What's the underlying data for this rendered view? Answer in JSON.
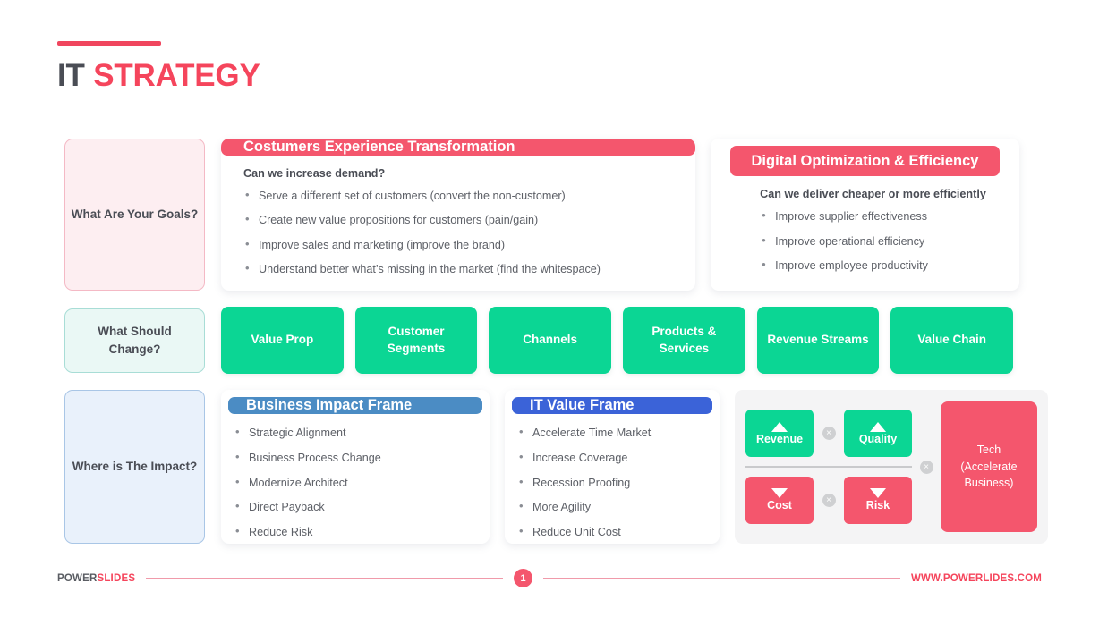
{
  "header": {
    "title_part1": "IT ",
    "title_part2": "STRATEGY"
  },
  "colors": {
    "accent_pink": "#f4566d",
    "accent_pink_text": "#f5455c",
    "green": "#0bd694",
    "blue_muted": "#4b8cc4",
    "blue_vivid": "#3b63d8",
    "text_dark": "#4a4d55",
    "text_body": "#5d6067"
  },
  "rows": {
    "goals": {
      "label": "What Are Your Goals?",
      "card_a": {
        "bar_title": "Costumers Experience Transformation",
        "subhead": "Can we increase demand?",
        "bullets": [
          "Serve a different set of customers (convert the non-customer)",
          "Create new value propositions for customers (pain/gain)",
          "Improve sales and marketing (improve the brand)",
          "Understand better what’s missing in the market (find the whitespace)"
        ]
      },
      "card_b": {
        "bar_title": "Digital Optimization & Efficiency",
        "subhead": "Can we deliver cheaper or more efficiently",
        "bullets": [
          "Improve supplier effectiveness",
          "Improve operational efficiency",
          "Improve employee productivity"
        ]
      }
    },
    "change": {
      "label": "What Should Change?",
      "boxes": [
        "Value Prop",
        "Customer Segments",
        "Channels",
        "Products & Services",
        "Revenue Streams",
        "Value Chain"
      ]
    },
    "impact": {
      "label": "Where is The Impact?",
      "card_a": {
        "bar_title": "Business Impact Frame",
        "bullets": [
          "Strategic Alignment",
          "Business Process Change",
          "Modernize Architect",
          "Direct Payback",
          "Reduce Risk"
        ]
      },
      "card_b": {
        "bar_title": "IT Value Frame",
        "bullets": [
          "Accelerate Time Market",
          "Increase Coverage",
          "Recession Proofing",
          "More Agility",
          "Reduce Unit Cost"
        ]
      },
      "formula": {
        "numerator": [
          {
            "label": "Revenue",
            "direction": "up"
          },
          {
            "label": "Quality",
            "direction": "up"
          }
        ],
        "denominator": [
          {
            "label": "Cost",
            "direction": "down"
          },
          {
            "label": "Risk",
            "direction": "down"
          }
        ],
        "operator": "×",
        "result": "Tech (Accelerate Business)",
        "result_line1": "Tech",
        "result_line2": "(Accelerate",
        "result_line3": "Business)"
      }
    }
  },
  "footer": {
    "brand_part1": "POWER",
    "brand_part2": "SLIDES",
    "page_number": "1",
    "site": "WWW.POWERLIDES.COM"
  }
}
